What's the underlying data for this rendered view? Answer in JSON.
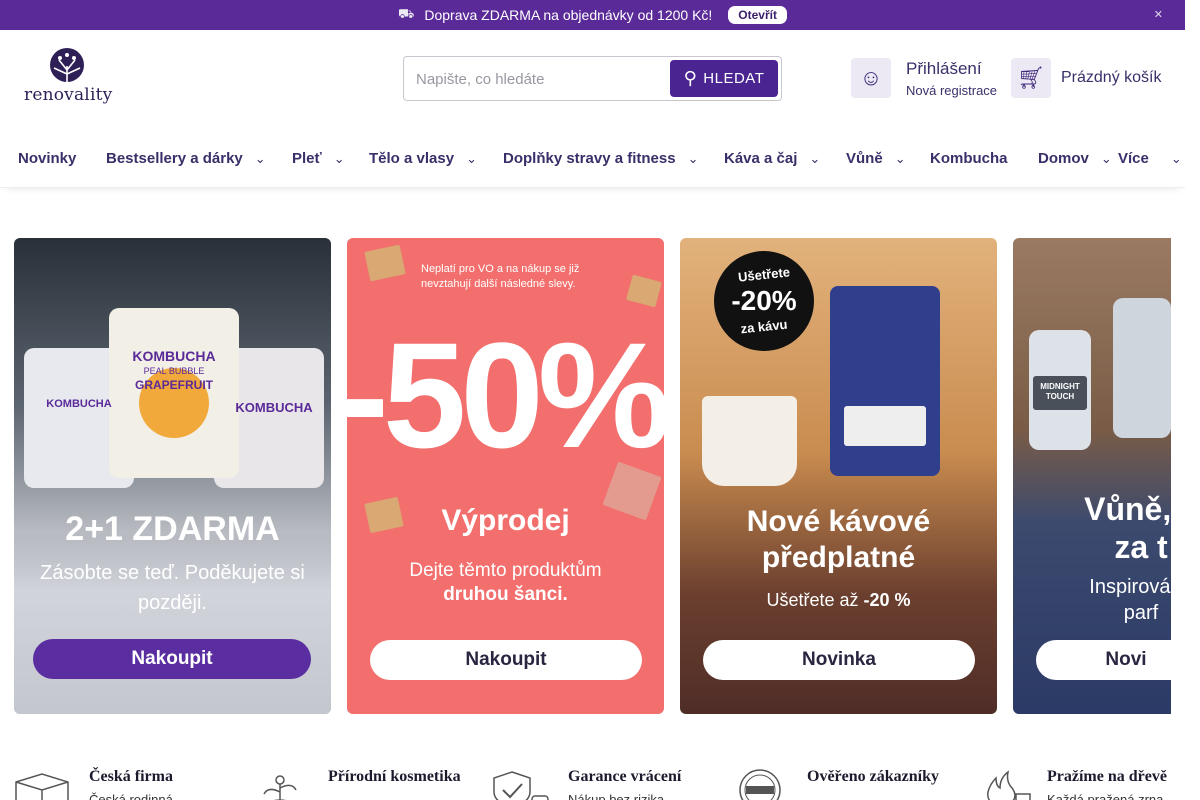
{
  "announcement": {
    "text": "Doprava ZDARMA na objednávky od 1200 Kč!",
    "button": "Otevřít",
    "truck_icon": "truck-icon",
    "close_icon": "close-icon"
  },
  "header": {
    "logo_text": "renovality",
    "search": {
      "placeholder": "Napište, co hledáte",
      "button": "HLEDAT"
    },
    "account": {
      "login": "Přihlášení",
      "register": "Nová registrace"
    },
    "cart": {
      "label": "Prázdný košík"
    }
  },
  "nav": [
    {
      "label": "Novinky",
      "dropdown": false
    },
    {
      "label": "Bestsellery a dárky",
      "dropdown": true
    },
    {
      "label": "Pleť",
      "dropdown": true
    },
    {
      "label": "Tělo a vlasy",
      "dropdown": true
    },
    {
      "label": "Doplňky stravy a fitness",
      "dropdown": true
    },
    {
      "label": "Káva a čaj",
      "dropdown": true
    },
    {
      "label": "Vůně",
      "dropdown": true
    },
    {
      "label": "Kombucha",
      "dropdown": false
    },
    {
      "label": "Domov",
      "dropdown": true
    },
    {
      "label": "Více",
      "dropdown": true
    }
  ],
  "banners": {
    "kombucha": {
      "pack_labels": [
        "KOMBUCHA",
        "PEAL BUBBLE",
        "GRAPEFRUIT",
        "KOMBUCHA",
        "KOMBUCHA"
      ],
      "headline": "2+1 ZDARMA",
      "subline": "Zásobte se teď. Poděkujete si později.",
      "cta": "Nakoupit"
    },
    "sale": {
      "note": "Neplatí pro VO a na nákup se již nevztahují další následné slevy.",
      "big": "-50%",
      "title": "Výprodej",
      "line1": "Dejte těmto produktům",
      "line2": "druhou šanci.",
      "cta": "Nakoupit"
    },
    "coffee": {
      "badge_top": "Ušetřete",
      "badge_value": "-20%",
      "badge_bottom": "za kávu",
      "title_line1": "Nové kávové",
      "title_line2": "předplatné",
      "line_prefix": "Ušetřete až",
      "line_value": "-20 %",
      "cta": "Novinka"
    },
    "perfume": {
      "title_line1": "Vůně, c",
      "title_line2": "za t",
      "line1": "Inspirováno",
      "line2": "parf",
      "cta": "Novi",
      "bottle_label": "MIDNIGHT TOUCH"
    }
  },
  "usp": [
    {
      "icon": "box-icon",
      "title": "Česká firma",
      "desc": "Česká rodinná"
    },
    {
      "icon": "plant-icon",
      "title": "Přírodní kosmetika",
      "desc": ""
    },
    {
      "icon": "shield-check-icon",
      "title": "Garance vrácení",
      "desc": "Nákup bez rizika"
    },
    {
      "icon": "verified-badge-icon",
      "title": "Ověřeno zákazníky",
      "desc": ""
    },
    {
      "icon": "fire-icon",
      "title": "Pražíme na dřevě",
      "desc": "Každá pražená zrna"
    }
  ],
  "colors": {
    "brand": "#5a2a98",
    "brand_dark": "#4a2490",
    "sale_bg": "#f26f6d",
    "nav_text": "#3b2f6a"
  }
}
